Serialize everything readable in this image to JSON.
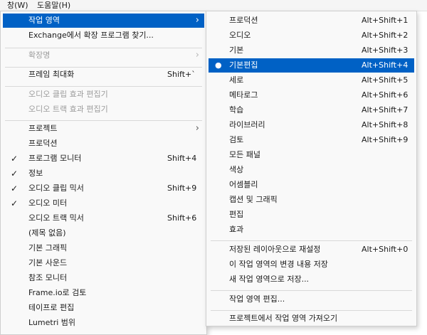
{
  "menubar": {
    "window_label": "창(W)",
    "help_label": "도움말(H)"
  },
  "menu_window": {
    "items": [
      {
        "label": "작업 영역",
        "shortcut": "",
        "arrow": "›"
      },
      {
        "label": "Exchange에서 확장 프로그램 찾기...",
        "shortcut": "",
        "arrow": ""
      },
      {
        "label": "확장명",
        "shortcut": "",
        "arrow": "›"
      },
      {
        "label": "프레임 최대화",
        "shortcut": "Shift+`",
        "arrow": ""
      },
      {
        "label": "오디오 클립 효과 편집기",
        "shortcut": "",
        "arrow": ""
      },
      {
        "label": "오디오 트랙 효과 편집기",
        "shortcut": "",
        "arrow": ""
      },
      {
        "label": "프로젝트",
        "shortcut": "",
        "arrow": "›"
      },
      {
        "label": "프로덕션",
        "shortcut": "",
        "arrow": ""
      },
      {
        "label": "프로그램 모니터",
        "shortcut": "Shift+4",
        "arrow": "",
        "check": "✓"
      },
      {
        "label": "정보",
        "shortcut": "",
        "arrow": "",
        "check": "✓"
      },
      {
        "label": "오디오 클립 믹서",
        "shortcut": "Shift+9",
        "arrow": "",
        "check": "✓"
      },
      {
        "label": "오디오 미터",
        "shortcut": "",
        "arrow": "",
        "check": "✓"
      },
      {
        "label": "오디오 트랙 믹서",
        "shortcut": "Shift+6",
        "arrow": ""
      },
      {
        "label": "(제목 없음)",
        "shortcut": "",
        "arrow": ""
      },
      {
        "label": "기본 그래픽",
        "shortcut": "",
        "arrow": ""
      },
      {
        "label": "기본 사운드",
        "shortcut": "",
        "arrow": ""
      },
      {
        "label": "참조 모니터",
        "shortcut": "",
        "arrow": ""
      },
      {
        "label": "Frame.io로 검토",
        "shortcut": "",
        "arrow": ""
      },
      {
        "label": "테이프로 편집",
        "shortcut": "",
        "arrow": ""
      },
      {
        "label": "Lumetri 범위",
        "shortcut": "",
        "arrow": ""
      }
    ]
  },
  "menu_workspaces": {
    "selected_marker": "●",
    "items": [
      {
        "label": "프로덕션",
        "shortcut": "Alt+Shift+1"
      },
      {
        "label": "오디오",
        "shortcut": "Alt+Shift+2"
      },
      {
        "label": "기본",
        "shortcut": "Alt+Shift+3"
      },
      {
        "label": "기본편집",
        "shortcut": "Alt+Shift+4"
      },
      {
        "label": "세로",
        "shortcut": "Alt+Shift+5"
      },
      {
        "label": "메타로그",
        "shortcut": "Alt+Shift+6"
      },
      {
        "label": "학습",
        "shortcut": "Alt+Shift+7"
      },
      {
        "label": "라이브러리",
        "shortcut": "Alt+Shift+8"
      },
      {
        "label": "검토",
        "shortcut": "Alt+Shift+9"
      },
      {
        "label": "모든 패널",
        "shortcut": ""
      },
      {
        "label": "색상",
        "shortcut": ""
      },
      {
        "label": "어셈블리",
        "shortcut": ""
      },
      {
        "label": "캡션 및 그래픽",
        "shortcut": ""
      },
      {
        "label": "편집",
        "shortcut": ""
      },
      {
        "label": "효과",
        "shortcut": ""
      },
      {
        "label": "저장된 레이아웃으로 재설정",
        "shortcut": "Alt+Shift+0"
      },
      {
        "label": "이 작업 영역의 변경 내용 저장",
        "shortcut": ""
      },
      {
        "label": "새 작업 영역으로 저장...",
        "shortcut": ""
      },
      {
        "label": "작업 영역 편집...",
        "shortcut": ""
      },
      {
        "label": "프로젝트에서 작업 영역 가져오기",
        "shortcut": ""
      }
    ]
  },
  "colors": {
    "highlight": "#0061c5",
    "disabled_text": "#9c9c9c"
  }
}
